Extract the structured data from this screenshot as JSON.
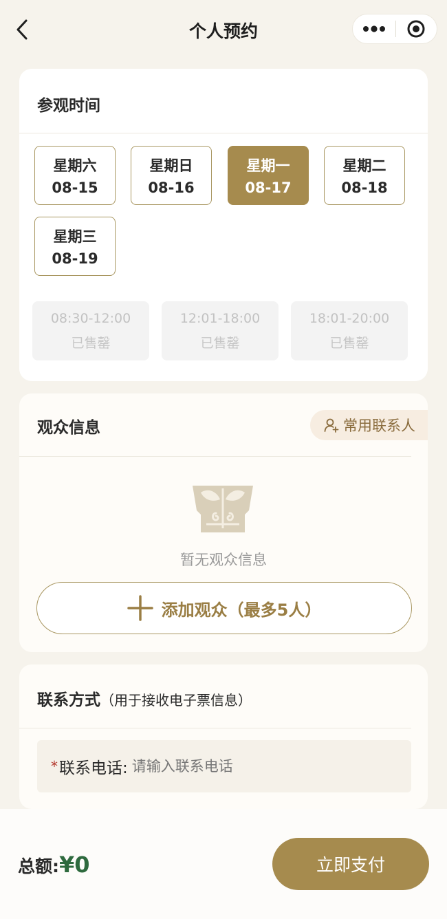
{
  "nav": {
    "title": "个人预约",
    "back_icon": "chevron-left-icon",
    "more_icon": "more-dots-icon",
    "close_icon": "target-close-icon"
  },
  "visit_time": {
    "title": "参观时间",
    "dates": [
      {
        "weekday": "星期六",
        "date": "08-15",
        "selected": false
      },
      {
        "weekday": "星期日",
        "date": "08-16",
        "selected": false
      },
      {
        "weekday": "星期一",
        "date": "08-17",
        "selected": true
      },
      {
        "weekday": "星期二",
        "date": "08-18",
        "selected": false
      },
      {
        "weekday": "星期三",
        "date": "08-19",
        "selected": false
      }
    ],
    "slots": [
      {
        "time": "08:30-12:00",
        "status": "已售罄"
      },
      {
        "time": "12:01-18:00",
        "status": "已售罄"
      },
      {
        "time": "18:01-20:00",
        "status": "已售罄"
      }
    ]
  },
  "audience": {
    "title": "观众信息",
    "contacts_button": "常用联系人",
    "contacts_icon": "add-user-icon",
    "empty_icon": "bronze-mask-icon",
    "empty_text": "暂无观众信息",
    "add_button": "添加观众（最多5人）",
    "add_icon": "plus-icon"
  },
  "contact": {
    "title": "联系方式",
    "subtitle": "（用于接收电子票信息）",
    "required_mark": "*",
    "phone_label": "联系电话:",
    "phone_placeholder": "请输入联系电话",
    "phone_value": ""
  },
  "footer": {
    "total_label": "总额:",
    "total_amount": "¥0",
    "pay_button": "立即支付"
  },
  "colors": {
    "accent": "#a68b4e",
    "background": "#f6f3ec",
    "amount": "#2e6a3e",
    "required": "#b3372c"
  }
}
